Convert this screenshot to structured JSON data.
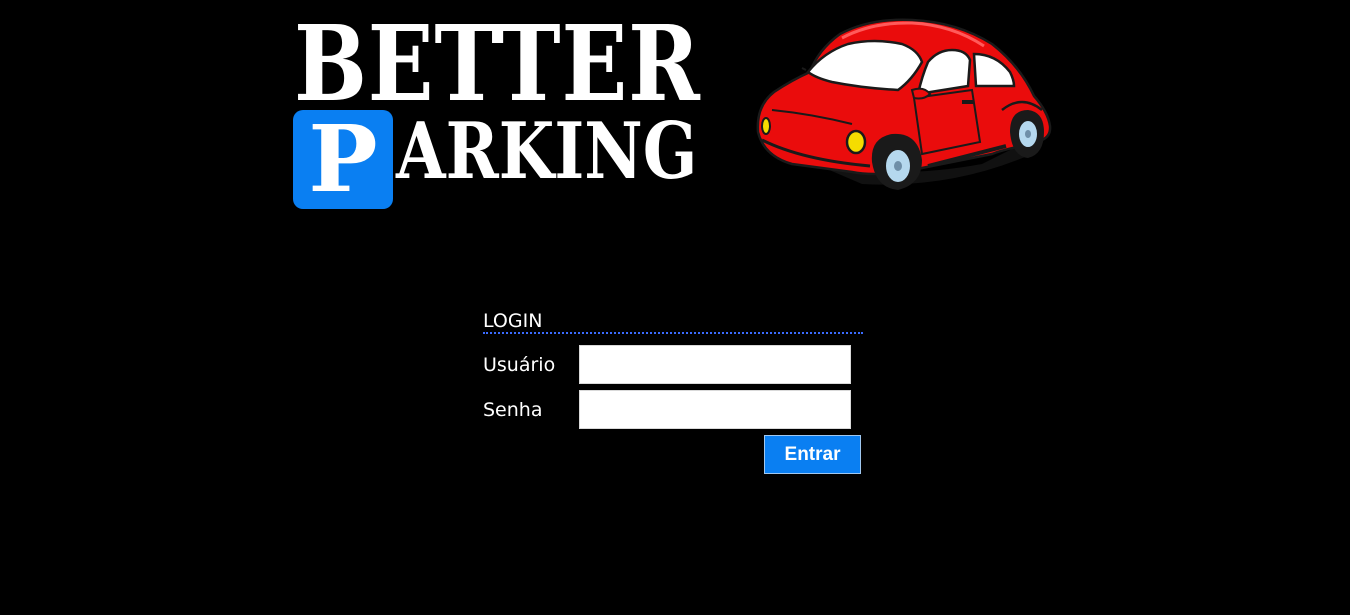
{
  "header": {
    "logo_line1": "BETTER",
    "logo_badge_letter": "P",
    "logo_line2": "ARKING",
    "logo_badge_color": "#0a7ff2",
    "car_illustration": "red-car-icon"
  },
  "login": {
    "title": "LOGIN",
    "username_label": "Usuário",
    "username_value": "",
    "password_label": "Senha",
    "password_value": "",
    "submit_label": "Entrar",
    "accent_color": "#0a7ff2",
    "divider_color": "#3a6bff"
  }
}
